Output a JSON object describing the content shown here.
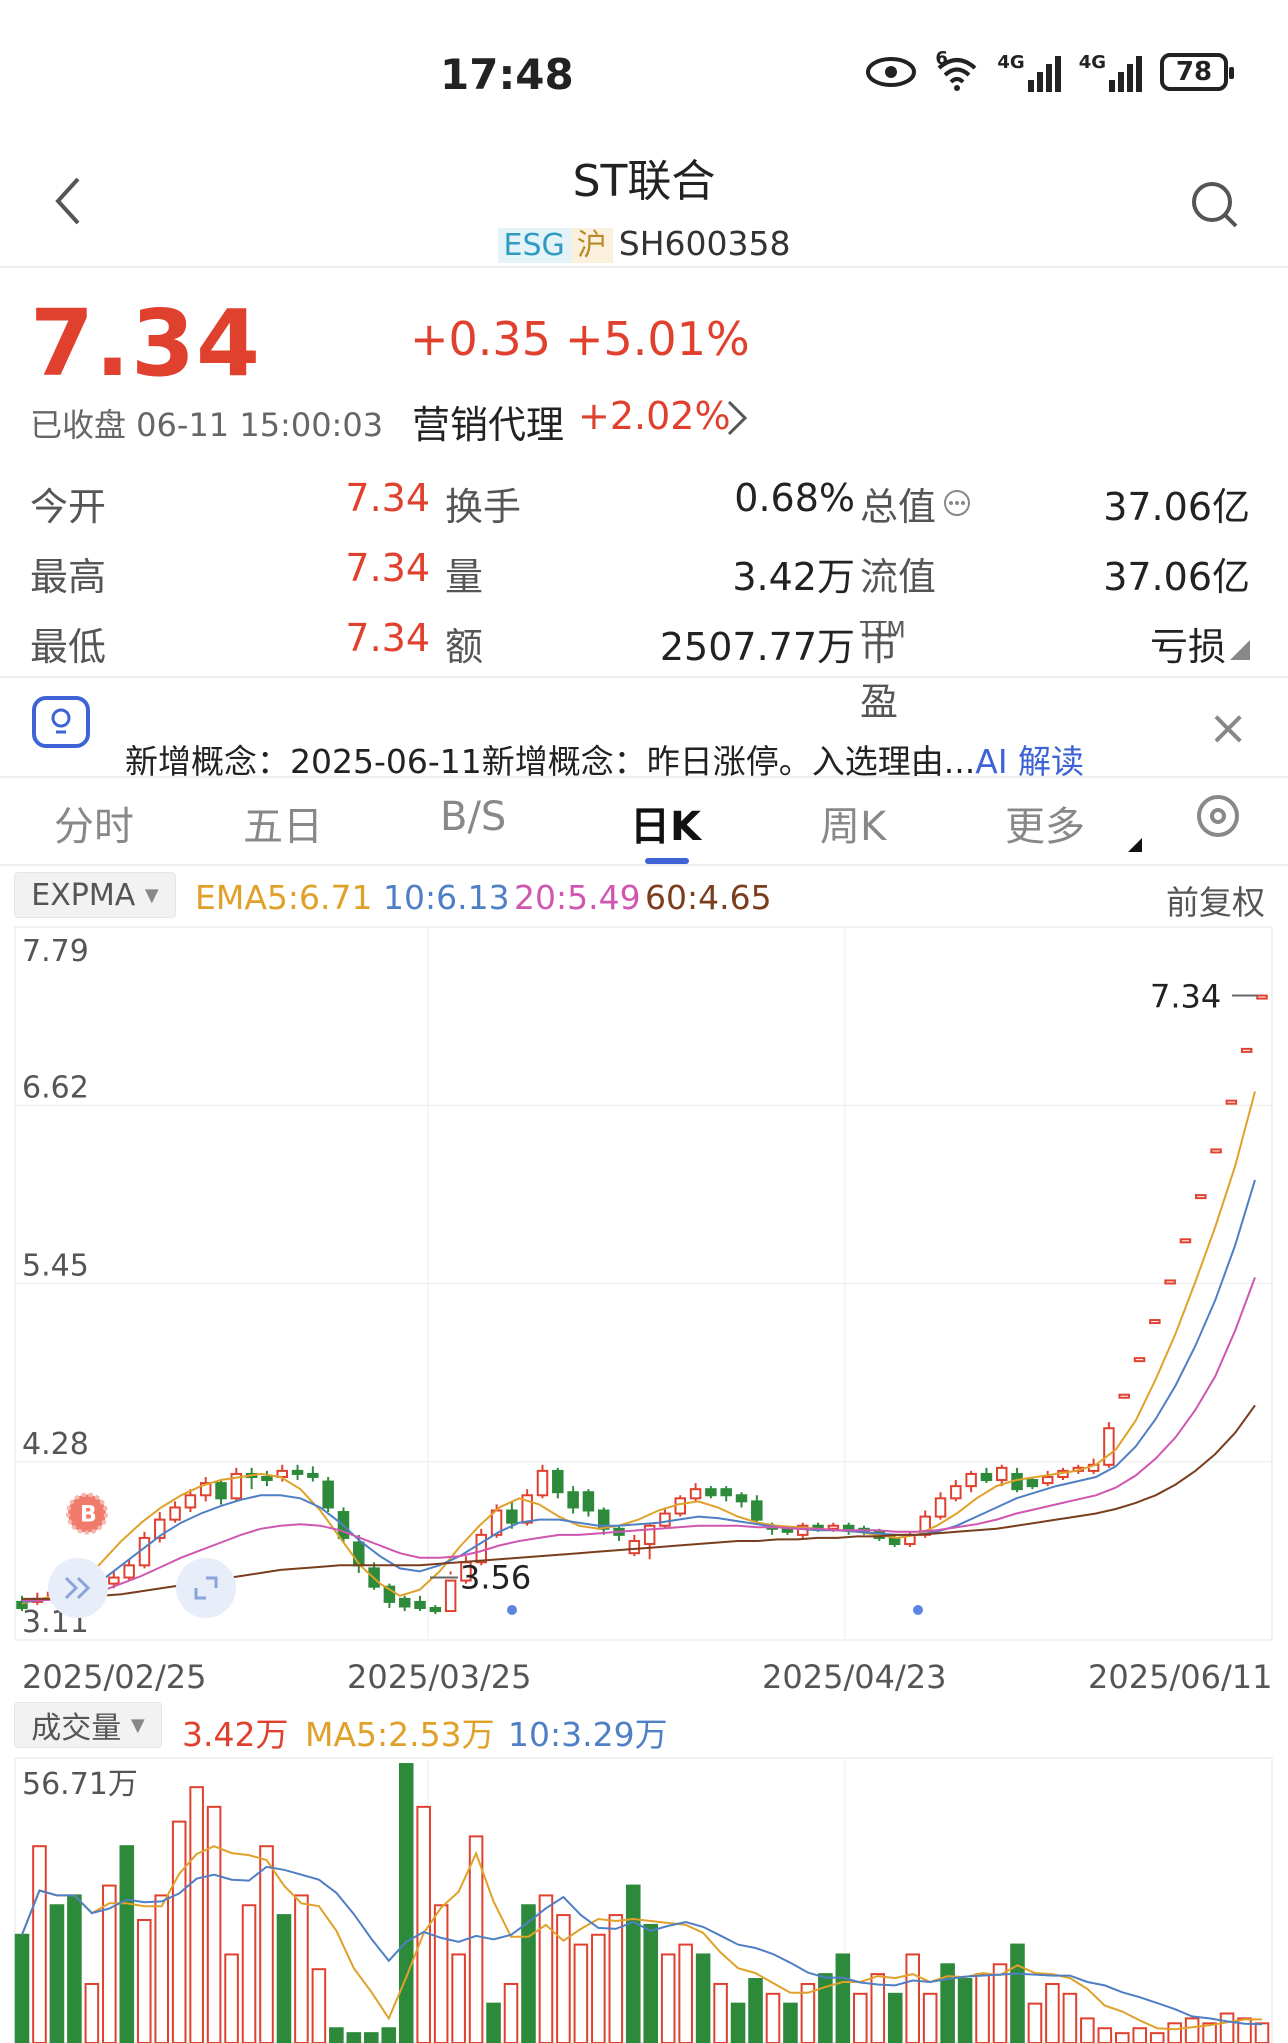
{
  "status_bar": {
    "time": "17:48",
    "battery": "78",
    "signal_1": "4G",
    "signal_2": "4G",
    "wifi_tag": "6"
  },
  "header": {
    "title": "ST联合",
    "tag_esg": "ESG",
    "tag_exchange": "沪",
    "code": "SH600358"
  },
  "quote": {
    "price": "7.34",
    "change": "+0.35",
    "change_pct": "+5.01%",
    "closed_time": "已收盘 06-11 15:00:03",
    "sector_name": "营销代理",
    "sector_pct": "+2.02%"
  },
  "stats": [
    {
      "l1": "今开",
      "v1": "7.34",
      "l2": "换手",
      "v2": "0.68%",
      "l3": "总值",
      "v3": "37.06亿"
    },
    {
      "l1": "最高",
      "v1": "7.34",
      "l2": "量",
      "v2": "3.42万",
      "l3": "流值",
      "v3": "37.06亿"
    },
    {
      "l1": "最低",
      "v1": "7.34",
      "l2": "额",
      "v2": "2507.77万",
      "l3": "市盈",
      "v3": "亏损"
    }
  ],
  "pe_superscript": "TTM",
  "news": {
    "text": "新增概念：2025-06-11新增概念：昨日涨停。入选理由...",
    "ai_label": "AI 解读"
  },
  "tabs": [
    "分时",
    "五日",
    "B/S",
    "日K",
    "周K",
    "更多"
  ],
  "active_tab": "日K",
  "indicators": {
    "name": "EXPMA",
    "ema5": "EMA5:6.71",
    "ema10": "10:6.13",
    "ema20": "20:5.49",
    "ema60": "60:4.65",
    "adjust": "前复权"
  },
  "volume_indicators": {
    "name": "成交量",
    "vol": "3.42万",
    "ma5": "MA5:2.53万",
    "ma10": "10:3.29万"
  },
  "colors": {
    "up": "#e0412f",
    "down": "#2c8a3a",
    "ema5": "#e0a12a",
    "ema10": "#4f7fc4",
    "ema20": "#d056b0",
    "ema60": "#7a3e1e",
    "accent": "#3d63d6"
  },
  "chart_data": {
    "type": "candlestick",
    "y_axis_labels": [
      "7.79",
      "6.62",
      "5.45",
      "4.28",
      "3.11"
    ],
    "ylim": [
      3.11,
      7.79
    ],
    "x_axis_labels": [
      "2025/02/25",
      "2025/03/25",
      "2025/04/23",
      "2025/06/11"
    ],
    "max_label": "7.34",
    "min_label": "3.56",
    "buy_marker": "B",
    "candles": [
      [
        3.36,
        3.32,
        3.4,
        3.3
      ],
      [
        3.36,
        3.38,
        3.42,
        3.34
      ],
      [
        3.38,
        3.42,
        3.45,
        3.35
      ],
      [
        3.42,
        3.45,
        3.5,
        3.4
      ],
      [
        3.45,
        3.4,
        3.48,
        3.38
      ],
      [
        3.4,
        3.48,
        3.52,
        3.38
      ],
      [
        3.48,
        3.52,
        3.56,
        3.45
      ],
      [
        3.52,
        3.6,
        3.64,
        3.5
      ],
      [
        3.6,
        3.78,
        3.82,
        3.58
      ],
      [
        3.78,
        3.9,
        3.95,
        3.75
      ],
      [
        3.9,
        3.98,
        4.02,
        3.88
      ],
      [
        3.98,
        4.06,
        4.1,
        3.95
      ],
      [
        4.06,
        4.14,
        4.18,
        4.02
      ],
      [
        4.14,
        4.04,
        4.16,
        4.0
      ],
      [
        4.04,
        4.2,
        4.24,
        4.02
      ],
      [
        4.2,
        4.18,
        4.24,
        4.1
      ],
      [
        4.18,
        4.16,
        4.22,
        4.12
      ],
      [
        4.18,
        4.22,
        4.26,
        4.15
      ],
      [
        4.22,
        4.2,
        4.26,
        4.16
      ],
      [
        4.2,
        4.19,
        4.25,
        4.15
      ],
      [
        4.15,
        3.98,
        4.18,
        3.95
      ],
      [
        3.95,
        3.78,
        3.98,
        3.75
      ],
      [
        3.75,
        3.6,
        3.8,
        3.55
      ],
      [
        3.58,
        3.46,
        3.62,
        3.44
      ],
      [
        3.46,
        3.36,
        3.48,
        3.32
      ],
      [
        3.38,
        3.33,
        3.4,
        3.3
      ],
      [
        3.36,
        3.32,
        3.4,
        3.3
      ],
      [
        3.32,
        3.3,
        3.34,
        3.28
      ],
      [
        3.3,
        3.5,
        3.54,
        3.56
      ],
      [
        3.5,
        3.62,
        3.66,
        3.48
      ],
      [
        3.62,
        3.8,
        3.84,
        3.6
      ],
      [
        3.8,
        3.96,
        4.0,
        3.78
      ],
      [
        3.96,
        3.88,
        4.02,
        3.84
      ],
      [
        3.88,
        4.06,
        4.1,
        3.86
      ],
      [
        4.06,
        4.22,
        4.26,
        4.04
      ],
      [
        4.22,
        4.08,
        4.24,
        4.04
      ],
      [
        4.08,
        3.98,
        4.12,
        3.94
      ],
      [
        4.08,
        3.96,
        4.1,
        3.92
      ],
      [
        3.96,
        3.84,
        3.98,
        3.8
      ],
      [
        3.84,
        3.8,
        3.86,
        3.76
      ],
      [
        3.68,
        3.76,
        3.8,
        3.66
      ],
      [
        3.74,
        3.86,
        3.88,
        3.64
      ],
      [
        3.86,
        3.94,
        3.98,
        3.84
      ],
      [
        3.94,
        4.04,
        4.06,
        3.92
      ],
      [
        4.04,
        4.1,
        4.14,
        4.02
      ],
      [
        4.1,
        4.06,
        4.12,
        4.04
      ],
      [
        4.1,
        4.06,
        4.12,
        4.02
      ],
      [
        4.06,
        4.02,
        4.08,
        3.98
      ],
      [
        4.02,
        3.9,
        4.06,
        3.88
      ],
      [
        3.86,
        3.84,
        3.88,
        3.8
      ],
      [
        3.84,
        3.82,
        3.86,
        3.8
      ],
      [
        3.8,
        3.86,
        3.88,
        3.78
      ],
      [
        3.86,
        3.84,
        3.88,
        3.82
      ],
      [
        3.84,
        3.86,
        3.88,
        3.82
      ],
      [
        3.86,
        3.84,
        3.88,
        3.8
      ],
      [
        3.84,
        3.82,
        3.86,
        3.8
      ],
      [
        3.82,
        3.78,
        3.84,
        3.76
      ],
      [
        3.78,
        3.74,
        3.8,
        3.72
      ],
      [
        3.74,
        3.8,
        3.82,
        3.72
      ],
      [
        3.8,
        3.92,
        3.96,
        3.78
      ],
      [
        3.92,
        4.04,
        4.08,
        3.9
      ],
      [
        4.04,
        4.12,
        4.16,
        4.02
      ],
      [
        4.12,
        4.2,
        4.22,
        4.08
      ],
      [
        4.2,
        4.16,
        4.24,
        4.14
      ],
      [
        4.16,
        4.24,
        4.26,
        4.12
      ],
      [
        4.2,
        4.1,
        4.24,
        4.08
      ],
      [
        4.16,
        4.12,
        4.18,
        4.1
      ],
      [
        4.14,
        4.18,
        4.22,
        4.12
      ],
      [
        4.18,
        4.22,
        4.24,
        4.16
      ],
      [
        4.22,
        4.24,
        4.26,
        4.2
      ],
      [
        4.22,
        4.26,
        4.3,
        4.2
      ],
      [
        4.26,
        4.5,
        4.54,
        4.24
      ],
      [
        4.72,
        4.72,
        4.72,
        4.72
      ],
      [
        4.96,
        4.96,
        4.96,
        4.96
      ],
      [
        5.21,
        5.21,
        5.21,
        5.21
      ],
      [
        5.47,
        5.47,
        5.47,
        5.47
      ],
      [
        5.74,
        5.74,
        5.74,
        5.74
      ],
      [
        6.03,
        6.03,
        6.03,
        6.03
      ],
      [
        6.33,
        6.33,
        6.33,
        6.33
      ],
      [
        6.65,
        6.65,
        6.65,
        6.65
      ],
      [
        6.99,
        6.99,
        6.99,
        6.99
      ],
      [
        7.34,
        7.34,
        7.34,
        7.34
      ]
    ],
    "ema_series": {
      "ema5": [
        3.35,
        3.38,
        3.42,
        3.48,
        3.62,
        3.76,
        3.88,
        3.98,
        4.06,
        4.12,
        4.16,
        4.18,
        4.2,
        4.18,
        4.1,
        3.96,
        3.78,
        3.6,
        3.48,
        3.4,
        3.44,
        3.56,
        3.72,
        3.86,
        3.98,
        4.04,
        4.0,
        3.92,
        3.86,
        3.84,
        3.86,
        3.9,
        3.96,
        4.0,
        4.02,
        3.98,
        3.92,
        3.88,
        3.86,
        3.85,
        3.84,
        3.83,
        3.82,
        3.8,
        3.78,
        3.8,
        3.86,
        3.94,
        4.04,
        4.12,
        4.16,
        4.18,
        4.2,
        4.22,
        4.26,
        4.36,
        4.55,
        4.82,
        5.12,
        5.46,
        5.82,
        6.22,
        6.71
      ],
      "ema10": [
        3.36,
        3.37,
        3.39,
        3.42,
        3.5,
        3.6,
        3.7,
        3.8,
        3.88,
        3.94,
        3.99,
        4.03,
        4.06,
        4.06,
        4.04,
        3.98,
        3.88,
        3.76,
        3.66,
        3.58,
        3.56,
        3.6,
        3.66,
        3.74,
        3.82,
        3.88,
        3.9,
        3.9,
        3.88,
        3.86,
        3.86,
        3.87,
        3.88,
        3.9,
        3.92,
        3.91,
        3.89,
        3.87,
        3.85,
        3.84,
        3.83,
        3.83,
        3.82,
        3.81,
        3.8,
        3.8,
        3.82,
        3.86,
        3.92,
        3.98,
        4.04,
        4.08,
        4.12,
        4.15,
        4.18,
        4.25,
        4.38,
        4.56,
        4.78,
        5.04,
        5.34,
        5.7,
        6.13
      ],
      "ema20": [
        3.37,
        3.37,
        3.38,
        3.39,
        3.43,
        3.48,
        3.53,
        3.59,
        3.65,
        3.7,
        3.75,
        3.8,
        3.84,
        3.86,
        3.87,
        3.86,
        3.83,
        3.78,
        3.73,
        3.68,
        3.65,
        3.65,
        3.66,
        3.69,
        3.73,
        3.76,
        3.78,
        3.8,
        3.8,
        3.81,
        3.82,
        3.83,
        3.84,
        3.85,
        3.86,
        3.86,
        3.86,
        3.85,
        3.85,
        3.84,
        3.84,
        3.83,
        3.83,
        3.83,
        3.82,
        3.82,
        3.83,
        3.85,
        3.87,
        3.9,
        3.94,
        3.97,
        4.0,
        4.03,
        4.06,
        4.11,
        4.19,
        4.3,
        4.44,
        4.62,
        4.84,
        5.14,
        5.49
      ],
      "ema60": [
        3.38,
        3.38,
        3.38,
        3.39,
        3.4,
        3.41,
        3.43,
        3.45,
        3.47,
        3.49,
        3.51,
        3.53,
        3.55,
        3.57,
        3.58,
        3.59,
        3.6,
        3.6,
        3.6,
        3.6,
        3.6,
        3.61,
        3.62,
        3.63,
        3.64,
        3.65,
        3.66,
        3.67,
        3.68,
        3.69,
        3.7,
        3.71,
        3.72,
        3.73,
        3.74,
        3.75,
        3.76,
        3.76,
        3.77,
        3.77,
        3.78,
        3.78,
        3.79,
        3.79,
        3.8,
        3.8,
        3.81,
        3.82,
        3.83,
        3.84,
        3.86,
        3.88,
        3.9,
        3.92,
        3.94,
        3.97,
        4.01,
        4.06,
        4.13,
        4.22,
        4.33,
        4.47,
        4.65
      ]
    },
    "volume_axis_label": "56.71万",
    "volumes": [
      [
        22,
        1
      ],
      [
        40,
        0
      ],
      [
        28,
        1
      ],
      [
        30,
        1
      ],
      [
        12,
        0
      ],
      [
        32,
        0
      ],
      [
        40,
        1
      ],
      [
        25,
        0
      ],
      [
        30,
        0
      ],
      [
        45,
        0
      ],
      [
        52,
        0
      ],
      [
        48,
        0
      ],
      [
        18,
        0
      ],
      [
        28,
        0
      ],
      [
        40,
        0
      ],
      [
        26,
        1
      ],
      [
        30,
        0
      ],
      [
        15,
        0
      ],
      [
        3,
        1
      ],
      [
        2,
        1
      ],
      [
        2,
        1
      ],
      [
        3,
        1
      ],
      [
        56.7,
        1
      ],
      [
        48,
        0
      ],
      [
        28,
        0
      ],
      [
        18,
        0
      ],
      [
        42,
        0
      ],
      [
        8,
        1
      ],
      [
        12,
        0
      ],
      [
        28,
        1
      ],
      [
        30,
        0
      ],
      [
        26,
        0
      ],
      [
        20,
        0
      ],
      [
        22,
        0
      ],
      [
        26,
        0
      ],
      [
        32,
        1
      ],
      [
        24,
        1
      ],
      [
        18,
        0
      ],
      [
        20,
        0
      ],
      [
        18,
        1
      ],
      [
        12,
        0
      ],
      [
        8,
        1
      ],
      [
        13,
        1
      ],
      [
        10,
        0
      ],
      [
        8,
        1
      ],
      [
        12,
        0
      ],
      [
        14,
        1
      ],
      [
        18,
        1
      ],
      [
        10,
        0
      ],
      [
        14,
        0
      ],
      [
        10,
        1
      ],
      [
        18,
        0
      ],
      [
        10,
        0
      ],
      [
        16,
        1
      ],
      [
        13,
        1
      ],
      [
        14,
        0
      ],
      [
        16,
        0
      ],
      [
        20,
        1
      ],
      [
        8,
        0
      ],
      [
        12,
        0
      ],
      [
        10,
        0
      ],
      [
        5,
        0
      ],
      [
        3,
        0
      ],
      [
        2,
        0
      ],
      [
        3,
        0
      ],
      [
        2,
        0
      ],
      [
        4,
        0
      ],
      [
        5,
        0
      ],
      [
        4,
        0
      ],
      [
        6,
        0
      ],
      [
        5,
        0
      ],
      [
        4,
        0
      ]
    ]
  }
}
